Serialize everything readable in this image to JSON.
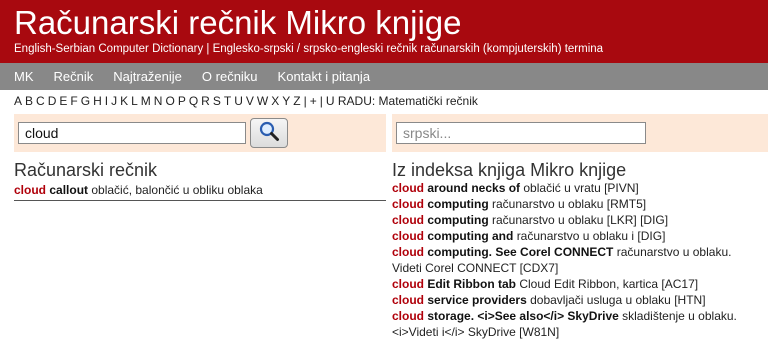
{
  "header": {
    "title": "Računarski rečnik Mikro knjige",
    "subtitle": "English-Serbian Computer Dictionary | Englesko-srpski / srpsko-engleski rečnik računarskih (kompjuterskih) termina"
  },
  "nav": {
    "items": [
      "MK",
      "Rečnik",
      "Najtraženije",
      "O rečniku",
      "Kontakt i pitanja"
    ]
  },
  "alphabet": {
    "letters": [
      "A",
      "B",
      "C",
      "D",
      "E",
      "F",
      "G",
      "H",
      "I",
      "J",
      "K",
      "L",
      "M",
      "N",
      "O",
      "P",
      "Q",
      "R",
      "S",
      "T",
      "U",
      "V",
      "W",
      "X",
      "Y",
      "Z"
    ],
    "sep1": "|",
    "plus": "+",
    "sep2": "|",
    "in_progress": "U RADU: Matematički rečnik"
  },
  "search": {
    "english_value": "cloud",
    "serbian_placeholder": "srpski...",
    "button_icon": "magnifier-icon"
  },
  "dictionary": {
    "title": "Računarski rečnik",
    "entries": [
      {
        "kw": "cloud",
        "term": "callout",
        "translation": "oblačić, balončić u obliku oblaka"
      }
    ]
  },
  "index": {
    "title": "Iz indeksa knjiga Mikro knjige",
    "entries": [
      {
        "kw": "cloud",
        "term": "around necks of",
        "translation": "oblačić u vratu [PIVN]"
      },
      {
        "kw": "cloud",
        "term": "computing",
        "translation": "računarstvo u oblaku [RMT5]"
      },
      {
        "kw": "cloud",
        "term": "computing",
        "translation": "računarstvo u oblaku [LKR] [DIG]"
      },
      {
        "kw": "cloud",
        "term": "computing and",
        "translation": "računarstvo u oblaku i [DIG]"
      },
      {
        "kw": "cloud",
        "term": "computing. See Corel CONNECT",
        "translation": "računarstvo u oblaku. Videti Corel CONNECT [CDX7]"
      },
      {
        "kw": "cloud",
        "term": "Edit Ribbon tab",
        "translation": "Cloud Edit Ribbon, kartica [AC17]"
      },
      {
        "kw": "cloud",
        "term": "service providers",
        "translation": "dobavljači usluga u oblaku [HTN]"
      },
      {
        "kw": "cloud",
        "term": "storage. <i>See also</i> SkyDrive",
        "translation": "skladištenje u oblaku. <i>Videti i</i> SkyDrive [W81N]"
      }
    ]
  },
  "colors": {
    "header_bg": "#a8090f",
    "nav_bg": "#888888",
    "search_panel_bg": "#fde8d8",
    "keyword": "#b0000a"
  }
}
